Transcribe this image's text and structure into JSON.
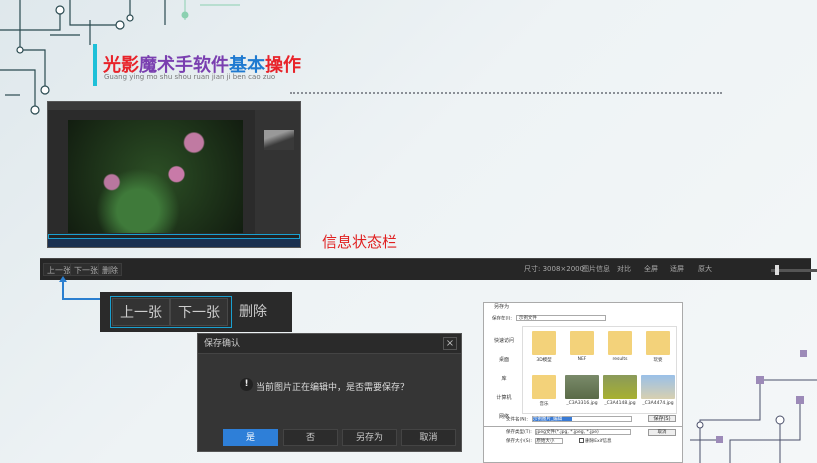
{
  "slide": {
    "title_parts": [
      "光影",
      "魔术手",
      "软件",
      "基本",
      "操作"
    ],
    "pinyin": "Guang ying mo shu shou ruan jian ji ben cao zuo",
    "info_label": "信息状态栏"
  },
  "status_bar": {
    "buttons": [
      "上一张",
      "下一张",
      "删除"
    ],
    "size_info": "尺寸: 3008×2000",
    "tools": [
      "图片信息",
      "对比",
      "全屏",
      "适屏",
      "原大"
    ]
  },
  "zoomed_buttons": [
    "上一张",
    "下一张",
    "删除"
  ],
  "save_confirm": {
    "title": "保存确认",
    "close": "×",
    "message": "当前图片正在编辑中，是否需要保存？",
    "warn_icon": "!",
    "buttons": [
      "是",
      "否",
      "另存为",
      "取消"
    ]
  },
  "save_as": {
    "title": "另存为",
    "location_label": "保存在(I):",
    "location_value": "示例文件",
    "sidebar": [
      "快速访问",
      "桌面",
      "库",
      "计算机",
      "网络"
    ],
    "files": [
      "3D模型",
      "NEF",
      "results",
      "玩耍",
      "音乐",
      "_C3A3316.jpg",
      "_C3A4148.jpg",
      "_C3A4474.jpg"
    ],
    "filename_label": "文件名(N):",
    "filename_value": "示例图片_编辑",
    "type_label": "保存类型(T):",
    "type_value": "jpeg文件(*.jpg, *.jpeg, *.jpe)",
    "size_label": "保存大小(S):",
    "size_value": "原始大小",
    "exif_label": "删除Exif信息",
    "save_button": "保存(S)",
    "cancel_button": "取消"
  }
}
